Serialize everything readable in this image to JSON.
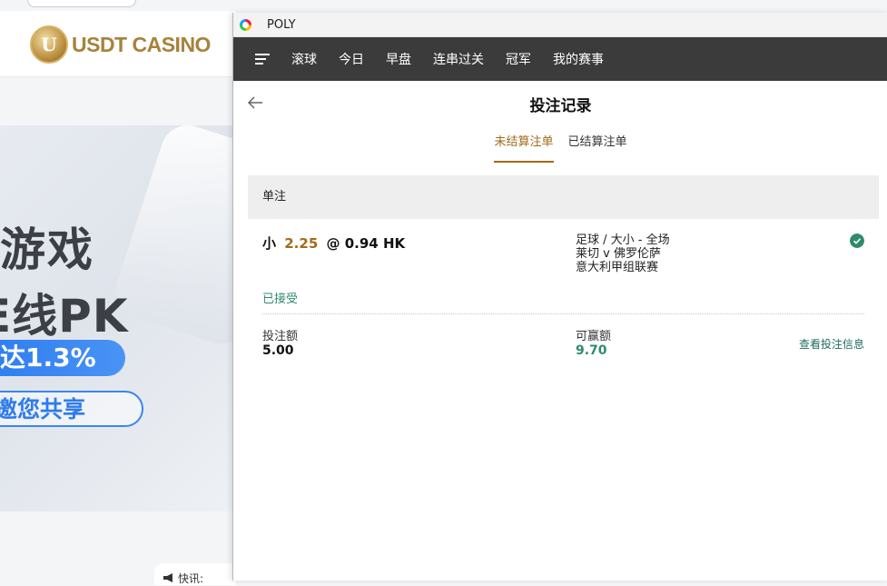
{
  "background": {
    "logo_letter": "U",
    "logo_text": "USDT CASINO",
    "banner_line1": "游戏",
    "banner_line2": "E线PK",
    "banner_pill1": "达1.3%",
    "banner_pill2": "邀您共享",
    "bottom_text": "快讯:"
  },
  "window": {
    "title": "POLY",
    "nav": [
      "滚球",
      "今日",
      "早盘",
      "连串过关",
      "冠军",
      "我的赛事"
    ],
    "page_title": "投注记录",
    "tabs": [
      {
        "label": "未结算注单",
        "active": true
      },
      {
        "label": "已结算注单",
        "active": false
      }
    ],
    "section_title": "单注",
    "bet": {
      "selection": "小",
      "line": "2.25",
      "at": "@",
      "odds": "0.94 HK",
      "sport_market": "足球 / 大小 - 全场",
      "match": "莱切 v 佛罗伦萨",
      "league": "意大利甲组联赛",
      "status": "已接受",
      "stake_label": "投注额",
      "stake_value": "5.00",
      "win_label": "可赢额",
      "win_value": "9.70",
      "detail_link": "查看投注信息"
    }
  },
  "colors": {
    "accent": "#a06a18",
    "success": "#2e8b6c",
    "navbar": "#3b3b3b"
  }
}
